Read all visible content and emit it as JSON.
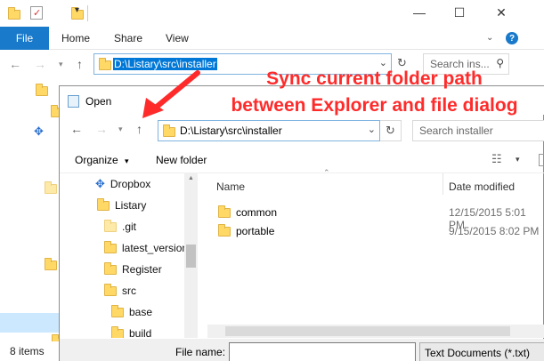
{
  "explorer": {
    "ribbon": {
      "file": "File",
      "home": "Home",
      "share": "Share",
      "view": "View"
    },
    "address": "D:\\Listary\\src\\installer",
    "search_placeholder": "Search ins...",
    "status": "8 items",
    "colors": {
      "ribbon_file": "#1979ca",
      "selection": "#0078d7"
    }
  },
  "annotation": {
    "line1": "Sync current folder path",
    "line2": "between Explorer and file dialog",
    "color": "#ff2b2b"
  },
  "dialog": {
    "title": "Open",
    "address": "D:\\Listary\\src\\installer",
    "search_placeholder": "Search installer",
    "toolbar": {
      "organize": "Organize",
      "new_folder": "New folder"
    },
    "tree": [
      {
        "label": "Dropbox",
        "icon": "dropbox-icon"
      },
      {
        "label": "Listary",
        "icon": "folder-icon"
      },
      {
        "label": ".git",
        "icon": "folder-icon"
      },
      {
        "label": "latest_version",
        "icon": "folder-icon"
      },
      {
        "label": "Register",
        "icon": "folder-icon"
      },
      {
        "label": "src",
        "icon": "folder-icon"
      },
      {
        "label": "base",
        "icon": "folder-icon"
      },
      {
        "label": "build",
        "icon": "folder-icon"
      }
    ],
    "columns": {
      "name": "Name",
      "date": "Date modified"
    },
    "files": [
      {
        "name": "common",
        "date": "12/15/2015 5:01 PM"
      },
      {
        "name": "portable",
        "date": "9/15/2015 8:02 PM"
      }
    ],
    "footer": {
      "file_name_label": "File name:",
      "file_type": "Text Documents (*.txt)"
    }
  }
}
